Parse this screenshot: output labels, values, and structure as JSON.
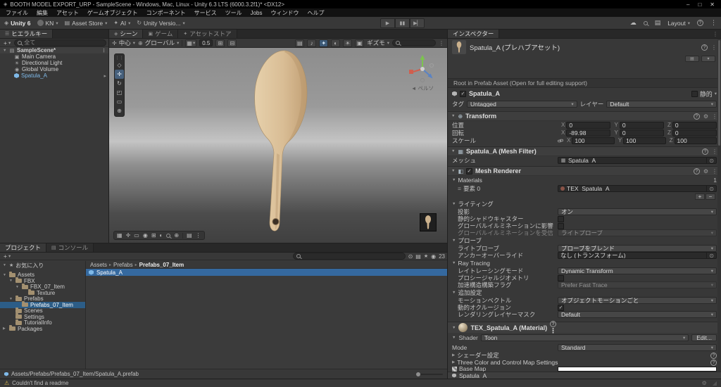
{
  "window": {
    "title": "BOOTH MODEL EXPORT_URP - SampleScene - Windows, Mac, Linux - Unity 6.3 LTS (6000.3.2f1)* <DX12>"
  },
  "menus": [
    "ファイル",
    "編集",
    "アセット",
    "ゲームオブジェクト",
    "コンポーネント",
    "サービス",
    "ツール",
    "Jobs",
    "ウィンドウ",
    "ヘルプ"
  ],
  "toolbar": {
    "brand": "Unity 6",
    "account": "KN",
    "asset_store": "Asset Store",
    "ai": "AI",
    "version_control": "Unity Versio...",
    "layout": "Layout"
  },
  "hierarchy": {
    "tab": "ヒエラルキー",
    "search_placeholder": "全て",
    "scene_name": "SampleScene*",
    "items": [
      {
        "label": "Main Camera"
      },
      {
        "label": "Directional Light"
      },
      {
        "label": "Global Volume"
      },
      {
        "label": "Spatula_A"
      }
    ]
  },
  "scene": {
    "tabs": [
      "シーン",
      "ゲーム",
      "アセットストア"
    ],
    "pivot": "中心",
    "orientation": "グローバル",
    "grid_size": "0.5",
    "gizmos": "ギズモ",
    "view_label": "ペルソ"
  },
  "project": {
    "tabs": [
      "プロジェクト",
      "コンソール"
    ],
    "hidden_count": "23",
    "favorites": "お気に入り",
    "tree": [
      {
        "label": "Assets"
      },
      {
        "label": "FBX"
      },
      {
        "label": "FBX_07_Item"
      },
      {
        "label": "Texture"
      },
      {
        "label": "Prefabs"
      },
      {
        "label": "Prefabs_07_Item"
      },
      {
        "label": "Scenes"
      },
      {
        "label": "Settings"
      },
      {
        "label": "TutorialInfo"
      },
      {
        "label": "Packages"
      }
    ],
    "breadcrumb": [
      "Assets",
      "Prefabs",
      "Prefabs_07_Item"
    ],
    "selected_item": "Spatula_A",
    "selected_path": "Assets/Prefabs/Prefabs_07_Item/Spatula_A.prefab"
  },
  "inspector": {
    "tab": "インスペクター",
    "header_title": "Spatula_A (プレハブアセット)",
    "root_note": "Root in Prefab Asset (Open for full editing support)",
    "game_object": {
      "name": "Spatula_A",
      "static_label": "静的",
      "tag_label": "タグ",
      "tag_value": "Untagged",
      "layer_label": "レイヤー",
      "layer_value": "Default"
    },
    "transform": {
      "title": "Transform",
      "position_label": "位置",
      "rotation_label": "回転",
      "scale_label": "スケール",
      "axis": {
        "x": "X",
        "y": "Y",
        "z": "Z"
      },
      "position": {
        "x": "0",
        "y": "0",
        "z": "0"
      },
      "rotation": {
        "x": "-89.98",
        "y": "0",
        "z": "0"
      },
      "scale": {
        "x": "100",
        "y": "100",
        "z": "100"
      }
    },
    "mesh_filter": {
      "title": "Spatula_A (Mesh Filter)",
      "mesh_label": "メッシュ",
      "mesh_value": "Spatula_A"
    },
    "mesh_renderer": {
      "title": "Mesh Renderer",
      "materials_label": "Materials",
      "materials_count": "1",
      "element0_label": "要素 0",
      "element0_value": "TEX_Spatula_A",
      "lighting_title": "ライティング",
      "cast_shadows_label": "投影",
      "cast_shadows_value": "オン",
      "static_shadow_label": "静的シャドウキャスター",
      "contribute_gi_label": "グローバルイルミネーションに影響",
      "receive_gi_label": "グローバルイルミネーションを受信",
      "receive_gi_value": "ライトプローブ",
      "probes_title": "プローブ",
      "light_probes_label": "ライトプローブ",
      "light_probes_value": "プローブをブレンド",
      "anchor_label": "アンカーオーバーライド",
      "anchor_value": "なし (トランスフォーム)",
      "ray_tracing_title": "Ray Tracing",
      "rt_mode_label": "レイトレーシングモード",
      "rt_mode_value": "Dynamic Transform",
      "procedural_label": "プロシージャルジオメトリ",
      "accel_label": "加速構造構築フラグ",
      "accel_value": "Prefer Fast Trace",
      "additional_title": "追加設定",
      "motion_label": "モーションベクトル",
      "motion_value": "オブジェクトモーションごと",
      "occlusion_label": "動的オクルージョン",
      "layer_mask_label": "レンダリングレイヤーマスク",
      "layer_mask_value": "Default"
    },
    "material": {
      "title": "TEX_Spatula_A (Material)",
      "shader_label": "Shader",
      "shader_value": "Toon",
      "edit_button": "Edit...",
      "mode_label": "Mode",
      "mode_value": "Standard",
      "shader_settings_label": "シェーダー設定",
      "three_color_label": "Three Color and Control Map Settings",
      "base_map_label": "Base Map"
    },
    "preview_title": "Spatula_A"
  },
  "status_bar": {
    "message": "Couldn't find a readme"
  },
  "ui": {
    "plus": "+",
    "minus": "−"
  }
}
